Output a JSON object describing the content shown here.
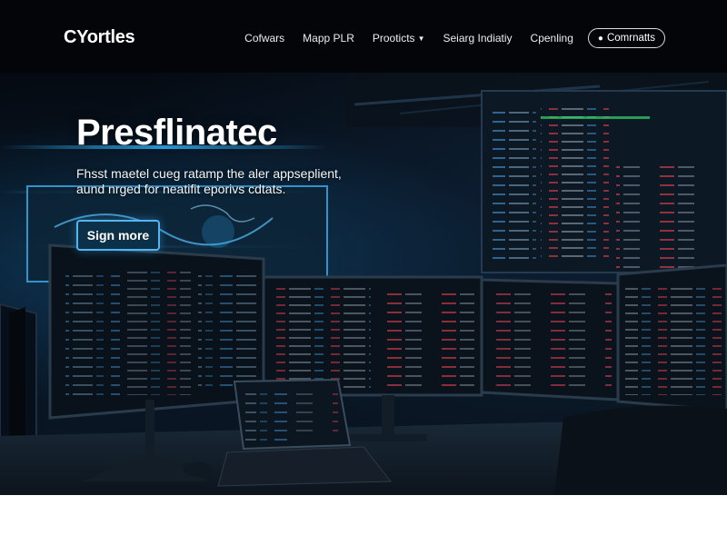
{
  "header": {
    "logo": "CYortles",
    "nav": [
      {
        "label": "Cofwars",
        "has_dropdown": false
      },
      {
        "label": "Mapp PLR",
        "has_dropdown": false
      },
      {
        "label": "Prooticts",
        "has_dropdown": true
      },
      {
        "label": "Seiarg Indiatiy",
        "has_dropdown": false
      },
      {
        "label": "Cpenling",
        "has_dropdown": false
      }
    ],
    "cta_label": "Comrnatts",
    "cta_icon": "user-icon"
  },
  "hero": {
    "title": "Presflinatec",
    "subtitle": "Fhsst maetel cueg ratamp the aler appseplient, aund nrged for neatifit eporivs cdtats.",
    "button_label": "Sign more"
  },
  "colors": {
    "header_bg": "#030508",
    "accent": "#53b6f2",
    "code_red": "#e0414f",
    "code_blue": "#4aa3e8"
  }
}
